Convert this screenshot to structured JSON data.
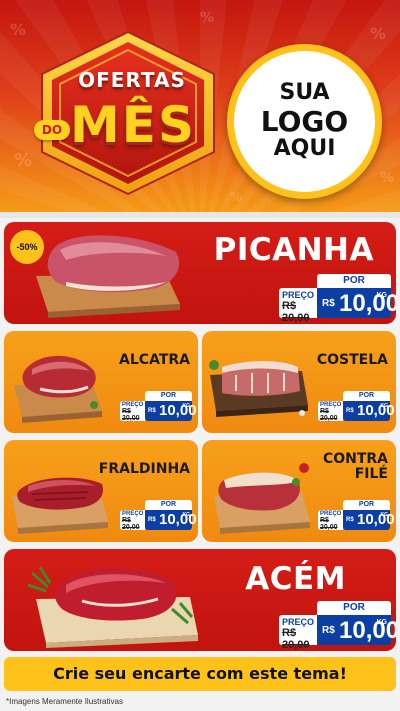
{
  "header": {
    "badge": {
      "ofertas": "OFERTAS",
      "do": "DO",
      "mes": "MÊS"
    },
    "logo": {
      "line1": "SUA",
      "line2": "LOGO",
      "line3": "AQUI"
    }
  },
  "colors": {
    "red": "#c8160f",
    "orange": "#f39414",
    "yellow": "#ffc21a",
    "blue": "#0c3fa4"
  },
  "products": {
    "picanha": {
      "name": "PICANHA",
      "discount": "-50%",
      "por": "POR",
      "preco": "PREÇO",
      "old": "R$ 20,00",
      "currency": "R$",
      "price": "10,00",
      "unit": "KG"
    },
    "alcatra": {
      "name": "ALCATRA",
      "por": "POR",
      "preco": "PREÇO",
      "old": "R$ 20,00",
      "currency": "R$",
      "price": "10,00",
      "unit": "KG"
    },
    "costela": {
      "name": "COSTELA",
      "por": "POR",
      "preco": "PREÇO",
      "old": "R$ 20,00",
      "currency": "R$",
      "price": "10,00",
      "unit": "KG"
    },
    "fraldinha": {
      "name": "FRALDINHA",
      "por": "POR",
      "preco": "PREÇO",
      "old": "R$ 20,00",
      "currency": "R$",
      "price": "10,00",
      "unit": "KG"
    },
    "contrafile": {
      "name_line1": "CONTRA",
      "name_line2": "FILÉ",
      "por": "POR",
      "preco": "PREÇO",
      "old": "R$ 20,00",
      "currency": "R$",
      "price": "10,00",
      "unit": "KG"
    },
    "acem": {
      "name": "ACÉM",
      "por": "POR",
      "preco": "PREÇO",
      "old": "R$ 20,00",
      "currency": "R$",
      "price": "10,00",
      "unit": "KG"
    }
  },
  "footer": {
    "banner": "Crie seu encarte com este tema!",
    "disclaimer": "*Imagens Meramente Ilustrativas"
  }
}
